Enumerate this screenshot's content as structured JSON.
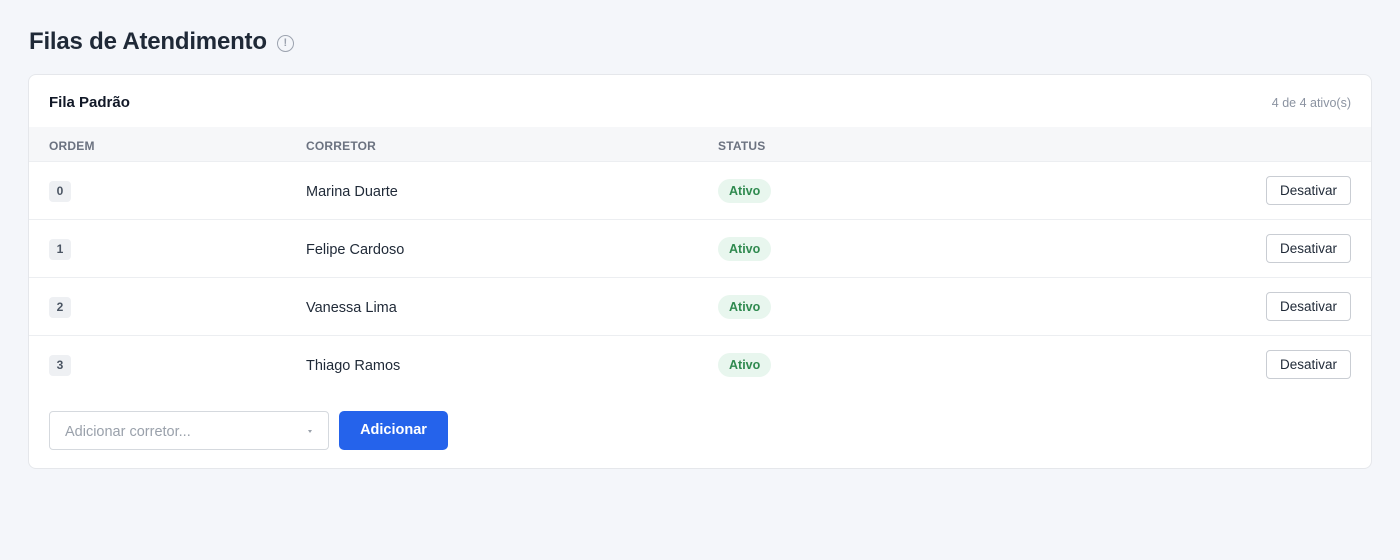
{
  "header": {
    "title": "Filas de Atendimento",
    "info_icon": "!"
  },
  "queue": {
    "title": "Fila Padrão",
    "count_text": "4 de 4 ativo(s)",
    "columns": [
      "ORDEM",
      "CORRETOR",
      "STATUS"
    ],
    "rows": [
      {
        "order": "0",
        "name": "Marina Duarte",
        "status": "Ativo",
        "action": "Desativar"
      },
      {
        "order": "1",
        "name": "Felipe Cardoso",
        "status": "Ativo",
        "action": "Desativar"
      },
      {
        "order": "2",
        "name": "Vanessa Lima",
        "status": "Ativo",
        "action": "Desativar"
      },
      {
        "order": "3",
        "name": "Thiago Ramos",
        "status": "Ativo",
        "action": "Desativar"
      }
    ]
  },
  "add": {
    "placeholder": "Adicionar corretor...",
    "button_label": "Adicionar"
  },
  "colors": {
    "primary": "#2563eb",
    "status_active_bg": "#e8f6ee",
    "status_active_text": "#2f8a4f",
    "page_bg": "#f4f6fa"
  },
  "icons": {
    "info": "info-icon",
    "select_caret": "chevron-down-icon"
  }
}
